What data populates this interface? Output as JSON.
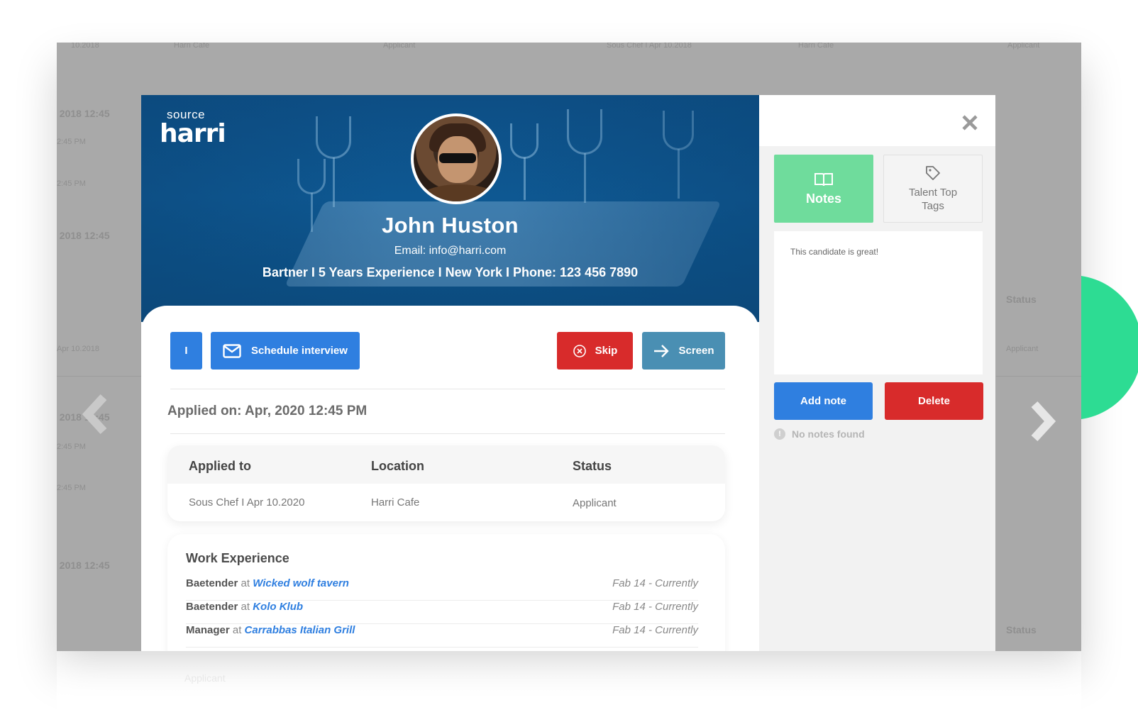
{
  "background": {
    "ghost_texts": [
      "10.2018",
      "Harri Cafe",
      "Applicant",
      "Sous Chef I Apr 10.2018",
      "Harri Cafe",
      "Applicant",
      ", 2018 12:45",
      "2:45 PM",
      "2:45 PM",
      ", 2018 12:45",
      "Status",
      "Apr 10.2018",
      "Applicant",
      ", 2018 12:45",
      "2:45 PM",
      "2:45 PM",
      ", 2018 12:45",
      "Status",
      "Applicant"
    ]
  },
  "logo": {
    "sub": "source",
    "main": "harri"
  },
  "candidate": {
    "name": "John Huston",
    "email": "Email: info@harri.com",
    "meta": "Bartner I 5 Years Experience I New York I Phone: 123 456 7890"
  },
  "actions": {
    "i_label": "I",
    "schedule_label": "Schedule interview",
    "skip_label": "Skip",
    "screen_label": "Screen"
  },
  "applied_on": "Applied on: Apr, 2020 12:45 PM",
  "application": {
    "headers": [
      "Applied to",
      "Location",
      "Status"
    ],
    "row": [
      "Sous Chef I  Apr 10.2020",
      "Harri Cafe",
      "Applicant"
    ]
  },
  "work_experience": {
    "title": "Work Experience",
    "at": "at",
    "items": [
      {
        "role": "Baetender",
        "company": "Wicked wolf tavern",
        "period": "Fab 14 - Currently"
      },
      {
        "role": "Baetender",
        "company": "Kolo Klub",
        "period": "Fab 14 - Currently"
      },
      {
        "role": "Manager",
        "company": "Carrabbas Italian Grill",
        "period": "Fab 14 - Currently"
      }
    ]
  },
  "side_panel": {
    "notes_tab": "Notes",
    "tags_tab_line1": "Talent Top",
    "tags_tab_line2": "Tags",
    "note_text": "This candidate is great!",
    "add_note": "Add note",
    "delete": "Delete",
    "no_notes": "No notes found",
    "info_glyph": "!"
  },
  "icons": {
    "close": "close-icon",
    "book": "book-icon",
    "tag": "tag-icon",
    "envelope": "envelope-icon",
    "x_circle": "x-circle-icon",
    "arrow_right": "arrow-right-icon",
    "prev": "chevron-left-icon",
    "next": "chevron-right-icon"
  },
  "colors": {
    "primary_blue": "#2f7fe0",
    "danger_red": "#d82b2b",
    "screen_blue": "#4a8fb3",
    "notes_green": "#6fdc9c",
    "accent_green": "#2ddc93"
  }
}
